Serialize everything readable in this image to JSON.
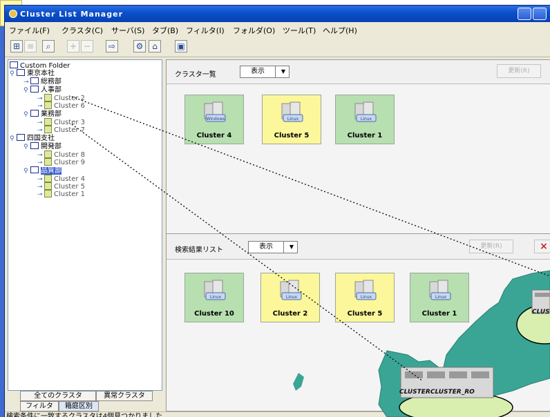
{
  "window": {
    "title": "Cluster List Manager"
  },
  "menu": [
    "ファイル(F)",
    "クラスタ(C)",
    "サーバ(S)",
    "タブ(B)",
    "フィルタ(I)",
    "フォルダ(O)",
    "ツール(T)",
    "ヘルプ(H)"
  ],
  "tree": {
    "root": "Custom Folder",
    "nodes": {
      "tokyo": "東京本社",
      "somu": "総務部",
      "jinji": "人事部",
      "cluster2": "Cluster 2",
      "cluster6": "Cluster 6",
      "eigyo": "業務部",
      "cluster3": "Cluster 3",
      "cluster7": "Cluster 7",
      "shikoku": "四国支社",
      "kaihatsu": "開発部",
      "cluster8": "Cluster 8",
      "cluster9": "Cluster 9",
      "hinshitsu": "品質部",
      "cluster4": "Cluster 4",
      "cluster5": "Cluster 5",
      "cluster1": "Cluster 1"
    }
  },
  "tabs": {
    "all": "全てのクラスタ",
    "abnormal": "異常クラスタ",
    "filter": "フィルタ",
    "category": "箱庭区別"
  },
  "status": "検索条件に一致するクラスタは4個見つかりました",
  "cluster_list": {
    "title": "クラスタ一覧",
    "display": "表示",
    "update_button": "更新(R)",
    "cards": [
      {
        "name": "Cluster 4",
        "os": "Windows",
        "color": "#b7dfb0"
      },
      {
        "name": "Cluster 5",
        "os": "Linux",
        "color": "#fbf79a"
      },
      {
        "name": "Cluster 1",
        "os": "Linux",
        "color": "#b7dfb0"
      }
    ]
  },
  "search_results": {
    "title": "検索結果リスト",
    "display": "表示",
    "update_button": "更新(R)",
    "close_icon": "×",
    "cards": [
      {
        "name": "Cluster 10",
        "os": "Linux",
        "color": "#b7dfb0"
      },
      {
        "name": "Cluster 2",
        "os": "Linux",
        "color": "#fbf79a"
      },
      {
        "name": "Cluster 5",
        "os": "Linux",
        "color": "#fbf79a"
      },
      {
        "name": "Cluster 1",
        "os": "Linux",
        "color": "#b7dfb0"
      }
    ]
  },
  "map_labels": {
    "right": "CLUS",
    "bottom": "CLUSTERCLUSTER_RO"
  }
}
